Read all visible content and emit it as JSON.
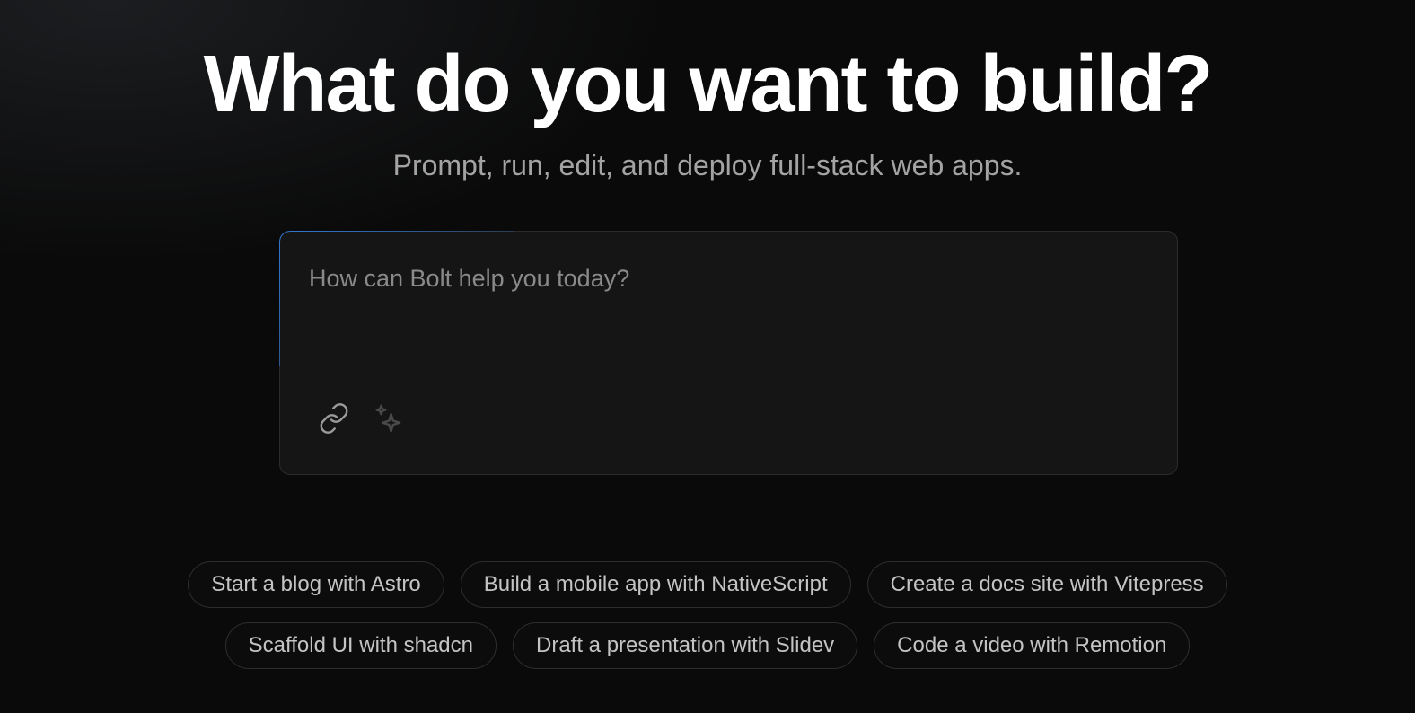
{
  "hero": {
    "title": "What do you want to build?",
    "subtitle": "Prompt, run, edit, and deploy full-stack web apps."
  },
  "prompt": {
    "placeholder": "How can Bolt help you today?",
    "value": "",
    "icons": {
      "attach": "link-icon",
      "enhance": "sparkles-icon"
    }
  },
  "suggestions": {
    "row1": [
      "Start a blog with Astro",
      "Build a mobile app with NativeScript",
      "Create a docs site with Vitepress"
    ],
    "row2": [
      "Scaffold UI with shadcn",
      "Draft a presentation with Slidev",
      "Code a video with Remotion"
    ]
  },
  "colors": {
    "background": "#0a0a0a",
    "accent_border": "#2f7ad8",
    "chip_text": "#c4c4c4",
    "subtitle_text": "#a3a3a3"
  }
}
